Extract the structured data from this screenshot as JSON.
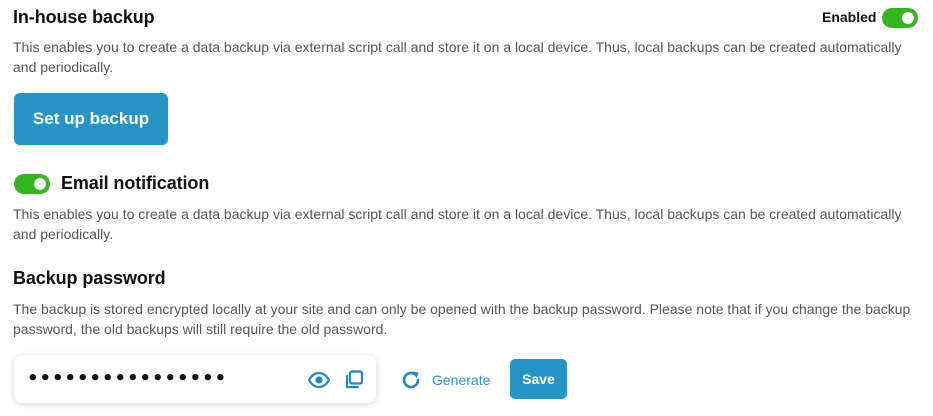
{
  "inhouse": {
    "title": "In-house backup",
    "status_label": "Enabled",
    "enabled": true,
    "description": "This enables you to create a data backup via external script call and store it on a local device. Thus, local backups can be created automatically and periodically.",
    "setup_button": "Set up backup"
  },
  "email": {
    "title": "Email notification",
    "enabled": true,
    "description": "This enables you to create a data backup via external script call and store it on a local device. Thus, local backups can be created automatically and periodically."
  },
  "password": {
    "title": "Backup password",
    "description": "The backup is stored encrypted locally at your site and can only be opened with the backup password. Please note that if you change the backup password, the old backups will still require the old password.",
    "masked_value": "••••••••••••••••",
    "show_icon": "eye-icon",
    "copy_icon": "copy-icon",
    "generate_icon": "refresh-icon",
    "generate_label": "Generate",
    "save_label": "Save"
  },
  "colors": {
    "accent": "#2695c5",
    "toggle_on": "#35b422",
    "link": "#2a8fc0"
  }
}
